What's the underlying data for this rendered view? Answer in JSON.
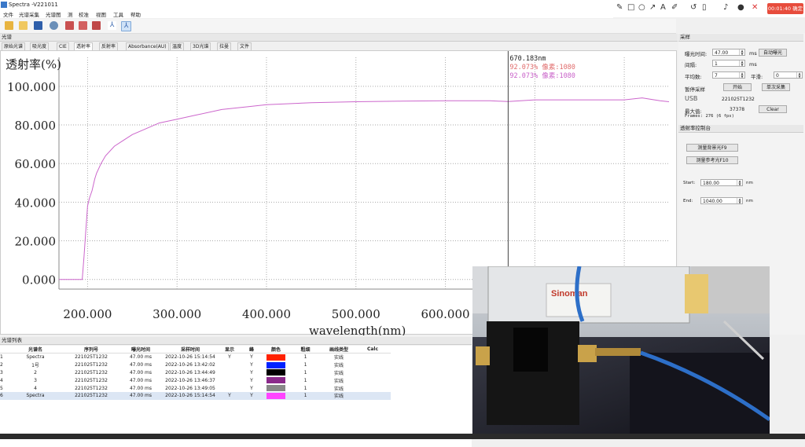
{
  "window": {
    "title": "Spectra -V221011"
  },
  "menu": [
    "文件",
    "光谱采集",
    "光谱图",
    "测",
    "校准",
    "视图",
    "工具",
    "帮助"
  ],
  "recorder": {
    "timer": "00:01:40 确定"
  },
  "spectrum_panel": {
    "header": "光谱"
  },
  "tabs": [
    "原始光谱",
    "吸光度",
    "CIE",
    "透射率",
    "反射率",
    "Absorbance(AU)",
    "温度",
    "3D光谱",
    "拉曼",
    "文件"
  ],
  "active_tab": 3,
  "chart_data": {
    "type": "line",
    "title": "透射率(%)",
    "xlabel": "wavelength(nm)",
    "ylabel": "",
    "xlim": [
      168,
      850
    ],
    "ylim": [
      -5,
      115
    ],
    "x_ticks": [
      "200.000",
      "300.000",
      "400.000",
      "500.000",
      "600.000"
    ],
    "x_tick_values": [
      200,
      300,
      400,
      500,
      600
    ],
    "y_ticks": [
      "0.000",
      "20.000",
      "40.000",
      "60.000",
      "80.000",
      "100.000"
    ],
    "y_tick_values": [
      0,
      20,
      40,
      60,
      80,
      100
    ],
    "cursor_wavelength": 670.183,
    "cursor_label": "670.183nm",
    "cursor_readouts": [
      "92.073% 像素:1080",
      "92.073% 像素:1080"
    ],
    "series": [
      {
        "color": "#cc66cc",
        "x": [
          190,
          194,
          196,
          198,
          200,
          202,
          205,
          208,
          210,
          215,
          220,
          230,
          240,
          250,
          260,
          280,
          300,
          320,
          350,
          380,
          400,
          450,
          500,
          550,
          600,
          650,
          670,
          700,
          750,
          800,
          820,
          840,
          850
        ],
        "y": [
          0,
          0,
          12,
          25,
          38,
          42,
          46,
          52,
          55,
          60,
          64,
          69,
          72,
          75,
          77,
          81,
          83,
          85,
          88,
          89.5,
          90.5,
          91.5,
          92,
          92.3,
          92.5,
          92.5,
          92.1,
          93,
          93,
          93,
          94,
          92.5,
          92
        ]
      }
    ],
    "grid": true
  },
  "right_panel": {
    "acq_header": "采样",
    "exposure_label": "曝光时间:",
    "exposure_value": "47.00",
    "exposure_unit": "ms",
    "auto_exposure": "自动曝光",
    "interval_label": "间隔:",
    "interval_value": "1",
    "interval_unit": "ms",
    "average_label": "平均数:",
    "average_value": "7",
    "smooth_label": "平滑:",
    "smooth_value": "0",
    "pause_label": "暂停采样",
    "start_btn": "开始",
    "single_btn": "单次采集",
    "usb_label": "USB",
    "usb_serial": "221025T1232",
    "max_label": "最大值:",
    "max_value": "37378",
    "clear_btn": "Clear",
    "frames_text": "Frames: 276 (6 fps)",
    "trans_header": "透射率控制台",
    "bg_btn": "测量背景光F9",
    "ref_btn": "测量参考光F10",
    "start_label": "Start:",
    "start_value": "180.00",
    "start_unit": "nm",
    "end_label": "End:",
    "end_value": "1040.00",
    "end_unit": "nm"
  },
  "list": {
    "header": "光谱列表",
    "columns": [
      "光谱名",
      "序列号",
      "曝光时间",
      "采样时间",
      "显示",
      "峰",
      "颜色",
      "粗细",
      "画线类型",
      "Calc"
    ],
    "rows": [
      {
        "idx": "1",
        "name": "Spectra",
        "serial": "221025T1232",
        "exp": "47.00 ms",
        "time": "2022-10-26 15:14:54",
        "show": "Y",
        "peak": "Y",
        "color": "#ff2200",
        "width": "1",
        "style": "实线"
      },
      {
        "idx": "2",
        "name": "1号",
        "serial": "221025T1232",
        "exp": "47.00 ms",
        "time": "2022-10-26 13:42:02",
        "show": "",
        "peak": "Y",
        "color": "#0022ff",
        "width": "1",
        "style": "实线"
      },
      {
        "idx": "3",
        "name": "2",
        "serial": "221025T1232",
        "exp": "47.00 ms",
        "time": "2022-10-26 13:44:49",
        "show": "",
        "peak": "Y",
        "color": "#000000",
        "width": "1",
        "style": "实线"
      },
      {
        "idx": "4",
        "name": "3",
        "serial": "221025T1232",
        "exp": "47.00 ms",
        "time": "2022-10-26 13:46:37",
        "show": "",
        "peak": "Y",
        "color": "#8b2a8b",
        "width": "1",
        "style": "实线"
      },
      {
        "idx": "5",
        "name": "4",
        "serial": "221025T1232",
        "exp": "47.00 ms",
        "time": "2022-10-26 13:49:05",
        "show": "",
        "peak": "Y",
        "color": "#888888",
        "width": "1",
        "style": "实线"
      },
      {
        "idx": "6",
        "name": "Spectra",
        "serial": "221025T1232",
        "exp": "47.00 ms",
        "time": "2022-10-26 15:14:54",
        "show": "Y",
        "peak": "Y",
        "color": "#ff44ff",
        "width": "1",
        "style": "实线"
      }
    ]
  },
  "photo": {
    "brand": "Sinoman"
  }
}
